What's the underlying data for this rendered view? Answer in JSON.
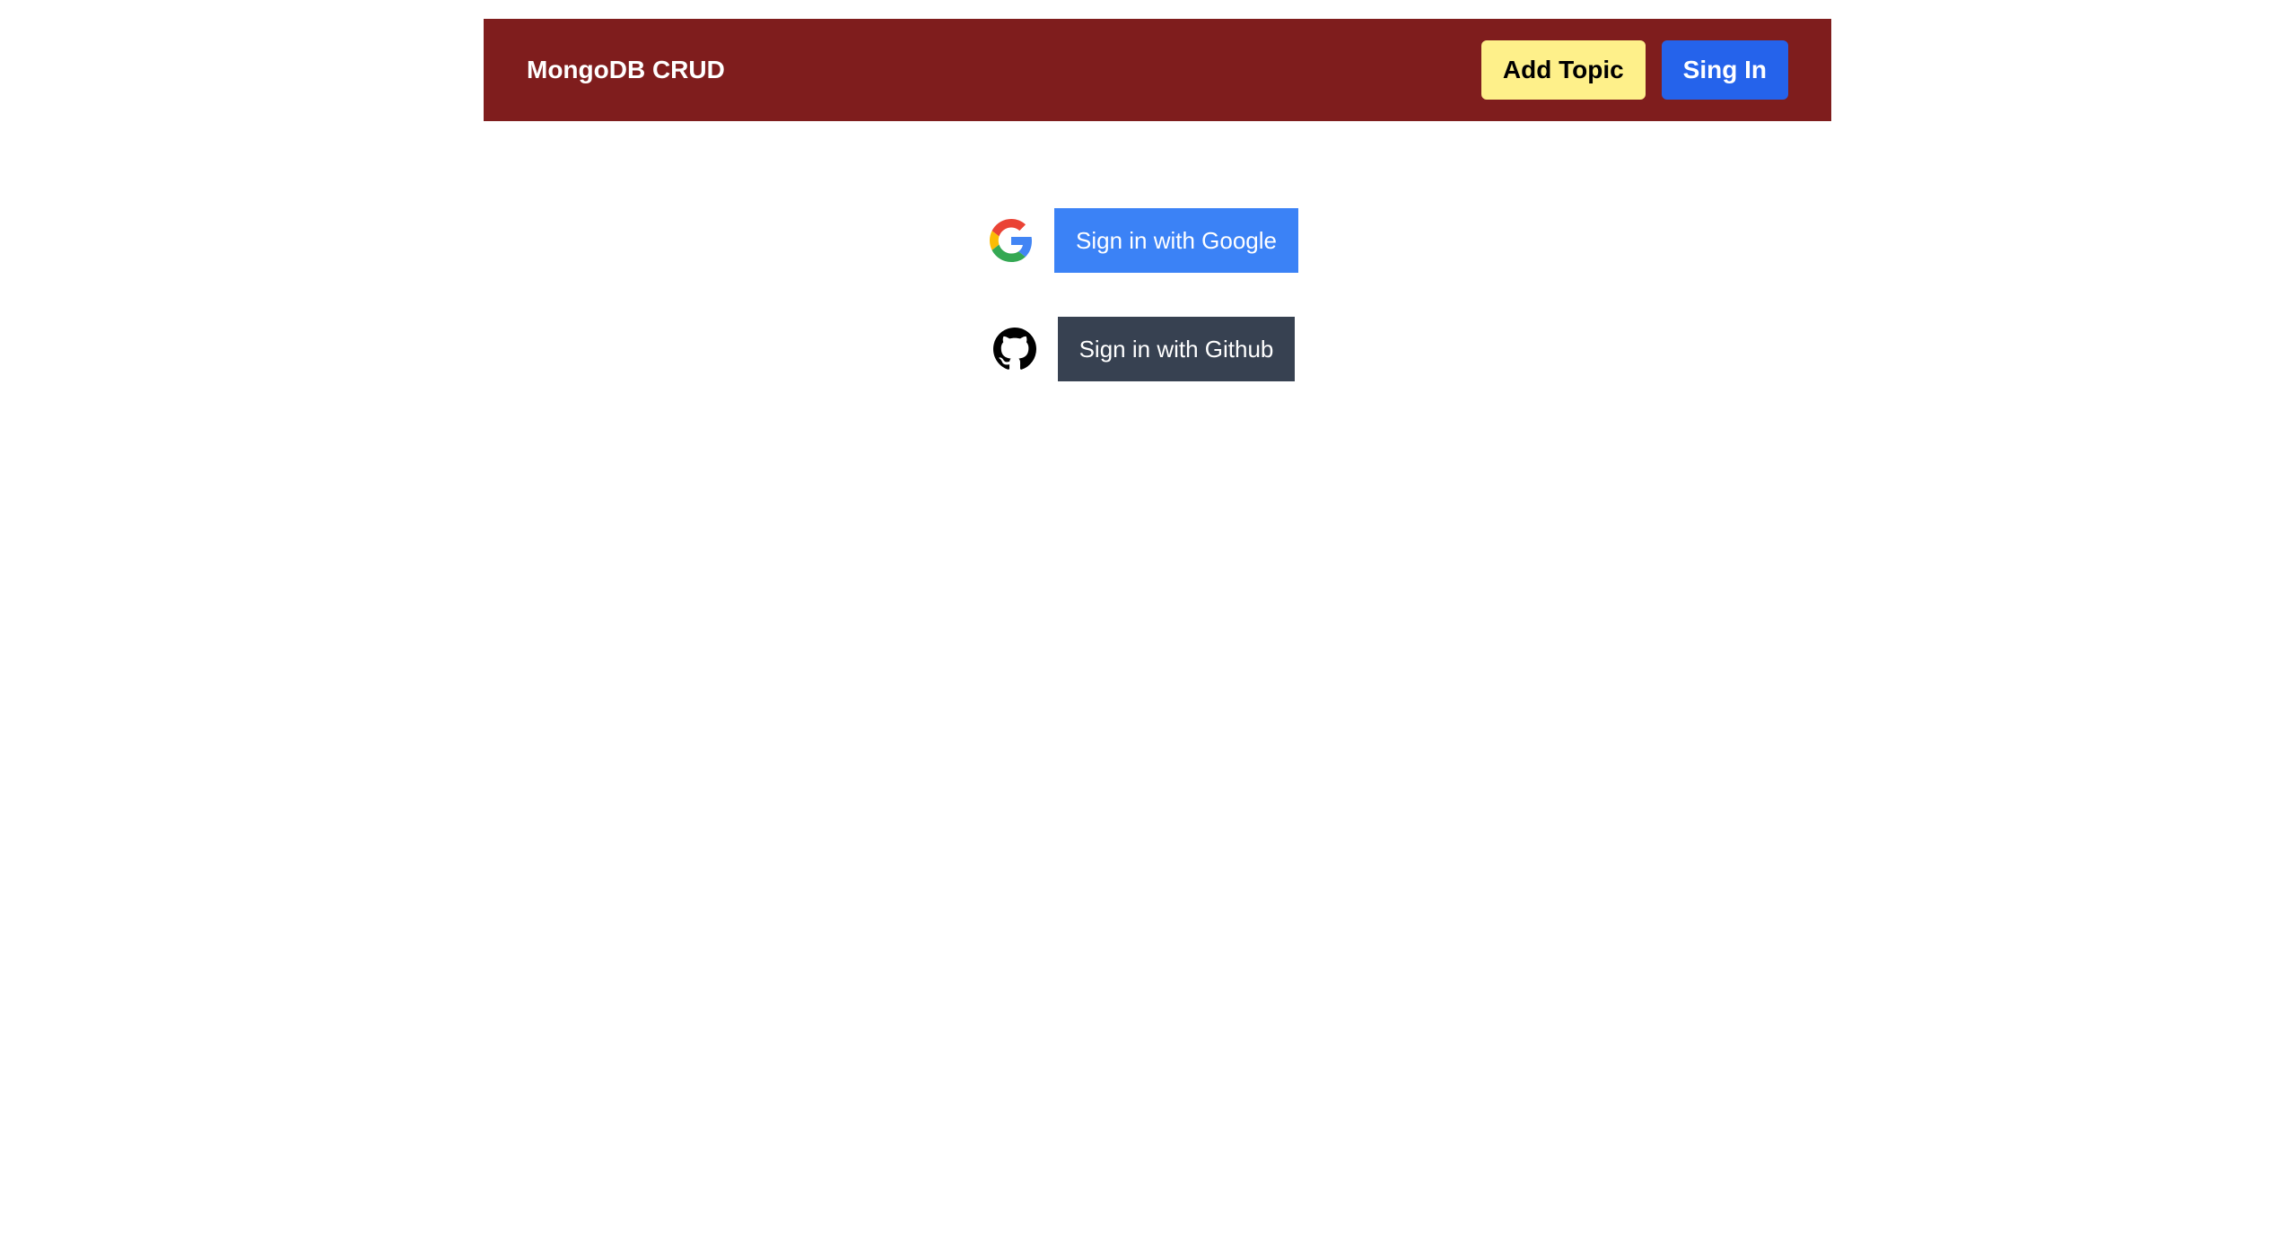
{
  "navbar": {
    "brand": "MongoDB CRUD",
    "add_topic_label": "Add Topic",
    "sign_in_label": "Sing In",
    "background_color": "#7f1d1d",
    "add_topic_color": "#fef08a",
    "sign_in_color": "#2563eb"
  },
  "auth": {
    "google": {
      "icon": "google-icon",
      "label": "Sign in with Google",
      "color": "#3b82f6"
    },
    "github": {
      "icon": "github-icon",
      "label": "Sign in with Github",
      "color": "#374151"
    }
  }
}
